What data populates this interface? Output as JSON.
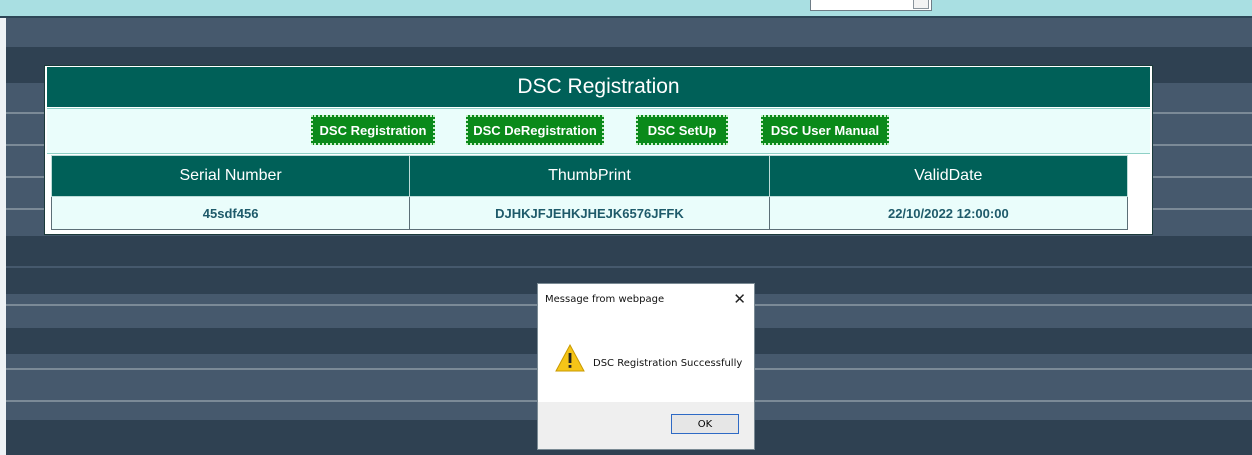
{
  "colors": {
    "header_teal": "#006058",
    "button_green": "#0a8a1a",
    "row_bg": "#eafdfb",
    "page_bg": "#46596d",
    "top_strip": "#a9dfe2",
    "warning_yellow": "#f5c518"
  },
  "panel": {
    "title": "DSC Registration",
    "buttons": [
      {
        "label": "DSC Registration"
      },
      {
        "label": "DSC DeRegistration"
      },
      {
        "label": "DSC SetUp"
      },
      {
        "label": "DSC User Manual"
      }
    ]
  },
  "table": {
    "headers": [
      "Serial Number",
      "ThumbPrint",
      "ValidDate"
    ],
    "rows": [
      [
        "45sdf456",
        "DJHKJFJEHKJHEJK6576JFFK",
        "22/10/2022 12:00:00"
      ]
    ]
  },
  "dialog": {
    "title": "Message from webpage",
    "message": "DSC Registration Successfully",
    "ok_label": "OK",
    "close_glyph": "✕",
    "icon": "warning-icon"
  }
}
